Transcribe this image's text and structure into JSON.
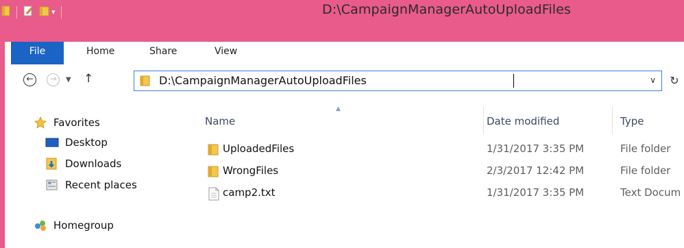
{
  "window": {
    "title": "D:\\CampaignManagerAutoUploadFiles",
    "accent": "#e85b8a"
  },
  "ribbon": {
    "tabs": [
      {
        "label": "File",
        "active": true,
        "color": "#1b63c4"
      },
      {
        "label": "Home"
      },
      {
        "label": "Share"
      },
      {
        "label": "View"
      }
    ]
  },
  "address_bar": {
    "path": "D:\\CampaignManagerAutoUploadFiles"
  },
  "navigation": {
    "groups": [
      {
        "label": "Favorites",
        "icon": "star-icon"
      },
      {
        "label": "Desktop",
        "icon": "desktop-icon"
      },
      {
        "label": "Downloads",
        "icon": "downloads-icon"
      },
      {
        "label": "Recent places",
        "icon": "recent-places-icon"
      },
      {
        "label": "Homegroup",
        "icon": "homegroup-icon"
      }
    ]
  },
  "file_list": {
    "columns": [
      "Name",
      "Date modified",
      "Type"
    ],
    "rows": [
      {
        "name": "UploadedFiles",
        "date": "1/31/2017 3:35 PM",
        "type": "File folder",
        "icon": "folder-icon"
      },
      {
        "name": "WrongFiles",
        "date": "2/3/2017 12:42 PM",
        "type": "File folder",
        "icon": "folder-icon"
      },
      {
        "name": "camp2.txt",
        "date": "1/31/2017 3:35 PM",
        "type": "Text Docum",
        "icon": "text-file-icon",
        "selected": true
      }
    ]
  }
}
